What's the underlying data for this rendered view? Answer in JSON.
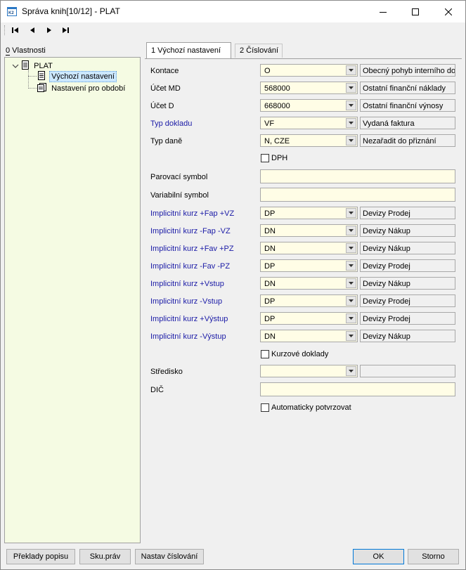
{
  "window": {
    "title": "Správa knih[10/12] - PLAT",
    "app_icon": "k2-app-icon",
    "controls": [
      "minimize-icon",
      "maximize-icon",
      "close-icon"
    ]
  },
  "toolbar": {
    "buttons": [
      "first-record-icon",
      "previous-record-icon",
      "next-record-icon",
      "last-record-icon"
    ]
  },
  "left_panel": {
    "label": "0 Vlastnosti",
    "tree": {
      "root": "PLAT",
      "children": [
        "Výchozí nastavení",
        "Nastavení pro období"
      ],
      "selected": "Výchozí nastavení"
    }
  },
  "tabs": [
    {
      "label": "1 Výchozí nastavení",
      "active": true
    },
    {
      "label": "2 Číslování",
      "active": false
    }
  ],
  "form": {
    "kontace": {
      "label": "Kontace",
      "value": "O",
      "desc": "Obecný pohyb interního do"
    },
    "ucet_md": {
      "label": "Účet MD",
      "value": "568000",
      "desc": "Ostatní finanční náklady"
    },
    "ucet_d": {
      "label": "Účet D",
      "value": "668000",
      "desc": "Ostatní finanční výnosy"
    },
    "typ_dokladu": {
      "label": "Typ dokladu",
      "value": "VF",
      "desc": "Vydaná faktura"
    },
    "typ_dane": {
      "label": "Typ daně",
      "value": "N, CZE",
      "desc": "Nezařadit do přiznání"
    },
    "dph": {
      "label": "DPH",
      "checked": false
    },
    "parovaci_symbol": {
      "label": "Parovací symbol",
      "value": ""
    },
    "variabilni_symbol": {
      "label": "Variabilní symbol",
      "value": ""
    },
    "kurzy": [
      {
        "label": "Implicitní kurz +Fap +VZ",
        "value": "DP",
        "desc": "Devizy Prodej"
      },
      {
        "label": "Implicitní kurz -Fap -VZ",
        "value": "DN",
        "desc": "Devizy Nákup"
      },
      {
        "label": "Implicitní kurz +Fav +PZ",
        "value": "DN",
        "desc": "Devizy Nákup"
      },
      {
        "label": "Implicitní kurz -Fav -PZ",
        "value": "DP",
        "desc": "Devizy Prodej"
      },
      {
        "label": "Implicitní kurz +Vstup",
        "value": "DN",
        "desc": "Devizy Nákup"
      },
      {
        "label": "Implicitní kurz -Vstup",
        "value": "DP",
        "desc": "Devizy Prodej"
      },
      {
        "label": "Implicitní kurz +Výstup",
        "value": "DP",
        "desc": "Devizy Prodej"
      },
      {
        "label": "Implicitní kurz -Výstup",
        "value": "DN",
        "desc": "Devizy Nákup"
      }
    ],
    "kurzove_doklady": {
      "label": "Kurzové doklady",
      "checked": false
    },
    "stredisko": {
      "label": "Středisko",
      "value": "",
      "desc": ""
    },
    "dic": {
      "label": "DIČ",
      "value": ""
    },
    "automaticky_potvrzovat": {
      "label": "Automaticky potvrzovat",
      "checked": false
    }
  },
  "buttons": {
    "preklady_popisu": "Překlady popisu",
    "sku_prav": "Sku.práv",
    "nastav_cislovani": "Nastav číslování",
    "ok": "OK",
    "storno": "Storno"
  },
  "colors": {
    "input_bg": "#fffde6",
    "tree_bg": "#f5fbe3",
    "link_label": "#1a1aa6",
    "selection": "#cce8ff"
  }
}
